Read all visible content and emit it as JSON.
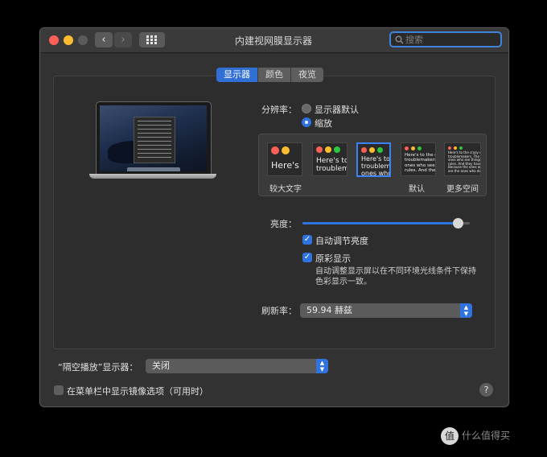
{
  "window": {
    "title": "内建视网膜显示器",
    "back_icon": "‹",
    "forward_icon": "›"
  },
  "search": {
    "placeholder": "搜索"
  },
  "tabs": [
    {
      "label": "显示器",
      "active": true
    },
    {
      "label": "颜色",
      "active": false
    },
    {
      "label": "夜览",
      "active": false
    }
  ],
  "resolution": {
    "label": "分辨率：",
    "options": [
      {
        "label": "显示器默认",
        "selected": false
      },
      {
        "label": "缩放",
        "selected": true
      }
    ]
  },
  "scaling": {
    "sample_text": "Here's to the crazy ones the misfits the rebels the troublemakers the round pegs in the square holes the ones who see things differently they're not fond of rules and they have no respect for the status quo",
    "thumb_texts": [
      "Here's",
      "Here's to\ntroublem",
      "Here's to t\ntroublema\nones who",
      "Here's to the c\ntroublemakers\nones who see t\nrules. And they",
      "Here's to the crazy one\ntroublemakers. The rou\nones who see things dif\nrules. And they have no\nBecause the ones who\nare the ones who do."
    ],
    "selected_index": 2,
    "captions": {
      "larger": "较大文字",
      "default": "默认",
      "more_space": "更多空间"
    }
  },
  "brightness": {
    "label": "亮度：",
    "level": 0.93
  },
  "auto_brightness": {
    "label": "自动调节亮度",
    "checked": true
  },
  "true_tone": {
    "label": "原彩显示",
    "checked": true,
    "description": "自动调整显示屏以在不同环境光线条件下保持色彩显示一致。"
  },
  "refresh_rate": {
    "label": "刷新率：",
    "value": "59.94 赫兹"
  },
  "airplay": {
    "label": "“隔空播放”显示器：",
    "value": "关闭"
  },
  "mirroring": {
    "label": "在菜单栏中显示镜像选项（可用时）",
    "checked": false
  },
  "help": {
    "label": "?"
  },
  "watermark": {
    "text": "值 什么值得买"
  },
  "colors": {
    "accent": "#2f73e0",
    "close": "#fe5f57",
    "minimize": "#febc2e",
    "window_bg": "#323232"
  }
}
